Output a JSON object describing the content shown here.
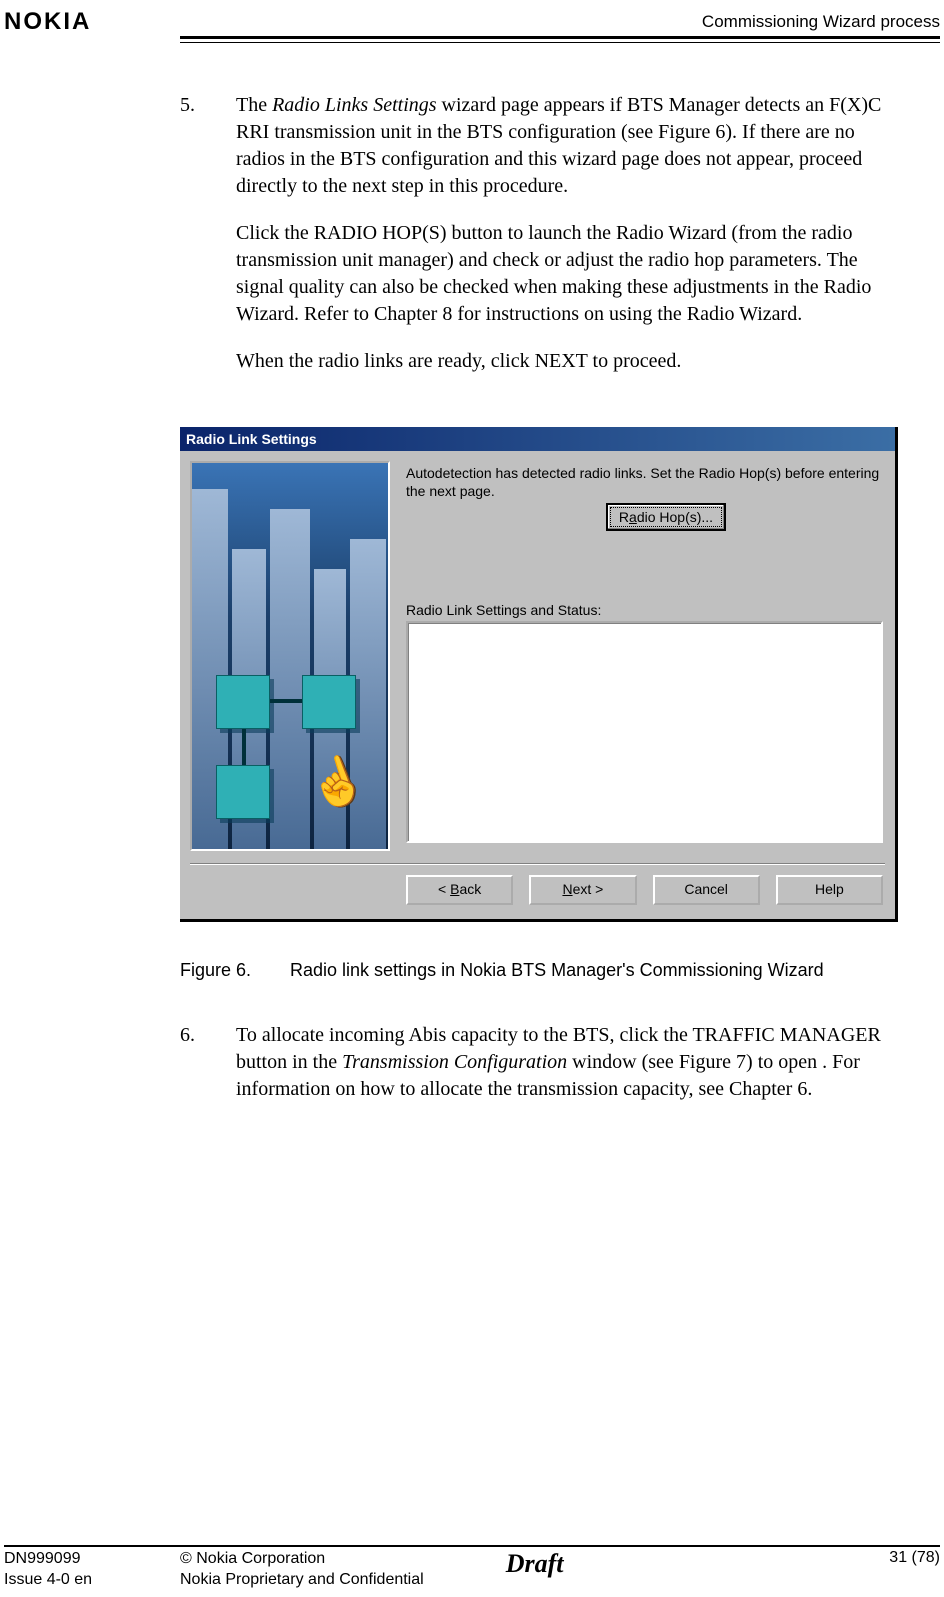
{
  "header": {
    "logo": "NOKIA",
    "title": "Commissioning Wizard process"
  },
  "steps": {
    "s5": {
      "num": "5.",
      "p1a": "The ",
      "p1b": "Radio Links Settings",
      "p1c": " wizard page appears if BTS Manager detects an F(X)C RRI transmission unit in the BTS configuration (see Figure 6). If there are no radios in the BTS configuration and this wizard page does not appear, proceed directly to the next step in this procedure.",
      "p2": "Click the RADIO HOP(S) button to launch the Radio Wizard (from the radio transmission unit manager) and check or adjust the radio hop parameters. The signal quality can also be checked when making these adjustments in the Radio Wizard. Refer to Chapter 8 for instructions on using the Radio Wizard.",
      "p3": "When the radio links are ready, click NEXT to proceed."
    },
    "s6": {
      "num": "6.",
      "p1a": "To allocate incoming Abis capacity to the BTS, click the TRAFFIC MANAGER button in the ",
      "p1b": "Transmission Configuration",
      "p1c": " window (see Figure 7) to open . For information on how to allocate the transmission capacity, see Chapter 6."
    }
  },
  "dialog": {
    "title": "Radio Link Settings",
    "instruction": "Autodetection has detected radio links. Set the Radio Hop(s) before entering the next page.",
    "radio_hop_pre": "R",
    "radio_hop_ul": "a",
    "radio_hop_post": "dio Hop(s)...",
    "section_label": "Radio Link Settings and Status:",
    "back_pre": "< ",
    "back_ul": "B",
    "back_post": "ack",
    "next_ul": "N",
    "next_post": "ext >",
    "cancel": "Cancel",
    "help": "Help"
  },
  "figure": {
    "num": "Figure 6.",
    "caption": "Radio link settings in Nokia BTS Manager's Commissioning Wizard"
  },
  "footer": {
    "doc_id": "DN999099",
    "issue": "Issue 4-0 en",
    "copyright": "© Nokia Corporation",
    "confidential": "Nokia Proprietary and Confidential",
    "draft": "Draft",
    "page": "31 (78)"
  }
}
